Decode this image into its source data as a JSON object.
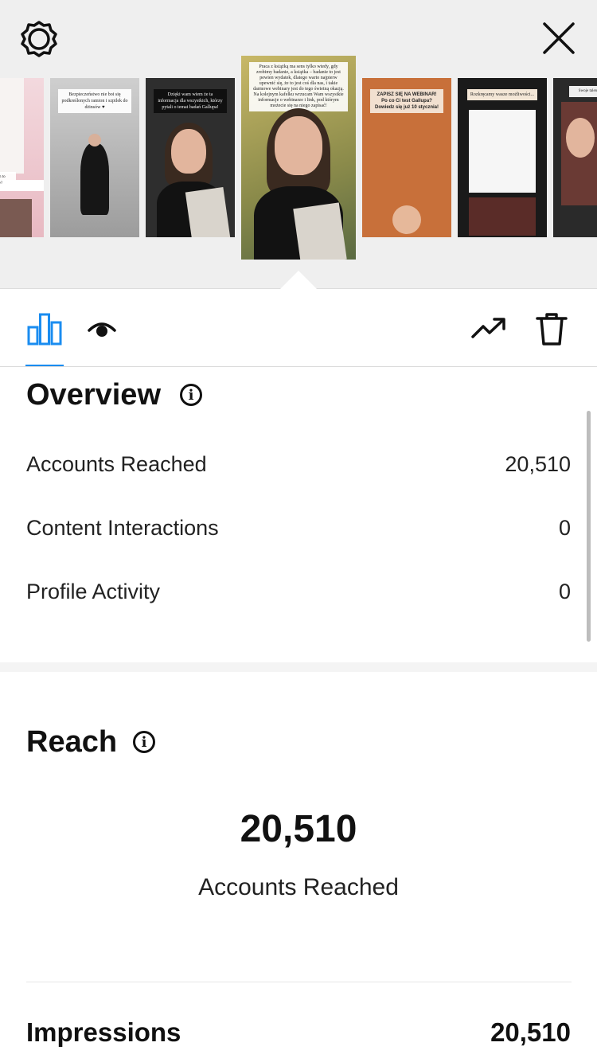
{
  "header": {
    "settings_icon": "gear-icon",
    "close_icon": "close-icon"
  },
  "stories": [
    {
      "caption": "... zdaniem to sumienie?"
    },
    {
      "caption": "Bezpieczeństwo nie boi się podkreślonych ramion i szpilek do dżinsów ♥"
    },
    {
      "caption": "Dzięki wam wiem że ta informacja dla wszystkich, którzy pytali o temat badań Gallupa!"
    },
    {
      "caption": "Praca z książką ma sens tylko wtedy, gdy zrobimy badanie, a książka – badanie to jest pewien wydatek, dlatego warto najpierw upewnić się, że to jest coś dla nas, i takie darmowe webinary jest do tego świetną okazją. Na kolejnym kafelku wrzucam Wam wszystkie informacje o webinarze i link, pod którym możecie się na niego zapisać!"
    },
    {
      "caption": "ZAPISZ SIĘ NA WEBINAR! Po co Ci test Gallupa? Dowiedz się już 10 stycznia!"
    },
    {
      "caption": "Rozkręcamy wasze możliwości..."
    },
    {
      "caption": "Swoje talenty..."
    }
  ],
  "tabs": {
    "insights_icon": "bar-chart-icon",
    "viewers_icon": "eye-icon",
    "promote_icon": "trending-up-icon",
    "delete_icon": "trash-icon"
  },
  "overview": {
    "title": "Overview",
    "rows": [
      {
        "label": "Accounts Reached",
        "value": "20,510"
      },
      {
        "label": "Content Interactions",
        "value": "0"
      },
      {
        "label": "Profile Activity",
        "value": "0"
      }
    ]
  },
  "reach": {
    "title": "Reach",
    "number": "20,510",
    "number_label": "Accounts Reached",
    "impressions_label": "Impressions",
    "impressions_value": "20,510"
  },
  "colors": {
    "accent": "#1a8cf0",
    "top_background": "#efefef"
  }
}
